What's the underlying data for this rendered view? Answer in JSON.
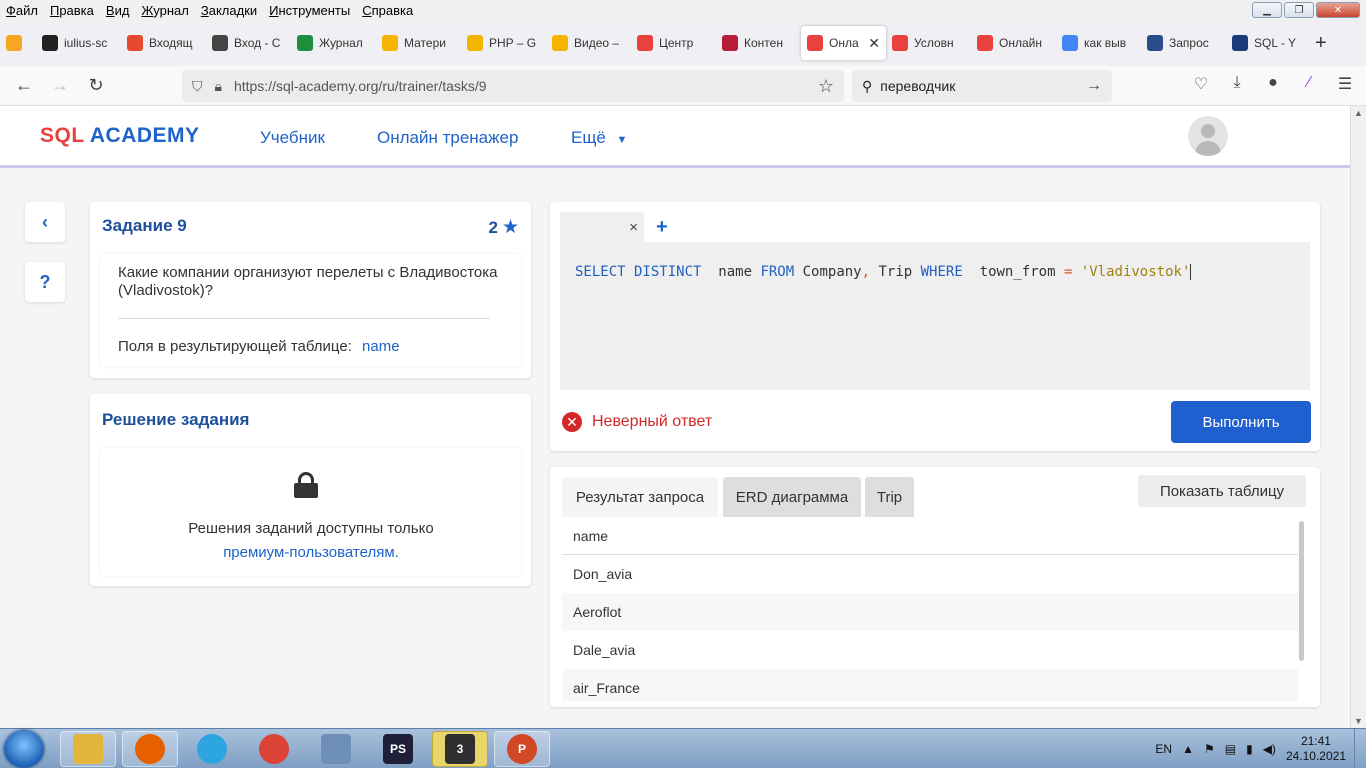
{
  "menu": [
    "Файл",
    "Правка",
    "Вид",
    "Журнал",
    "Закладки",
    "Инструменты",
    "Справка"
  ],
  "tabs": [
    {
      "label": "",
      "icon": "star-icon",
      "color": "#f5a623"
    },
    {
      "label": "iulius-sc",
      "icon": "github-icon",
      "color": "#222222"
    },
    {
      "label": "Входящ",
      "icon": "mail-icon",
      "color": "#e6492d"
    },
    {
      "label": "Вход - С",
      "icon": "asterisk-icon",
      "color": "#444444"
    },
    {
      "label": "Журнал",
      "icon": "sheets-icon",
      "color": "#1e8e3e"
    },
    {
      "label": "Матери",
      "icon": "drive-icon",
      "color": "#f4b400"
    },
    {
      "label": "PHP – G",
      "icon": "drive-icon",
      "color": "#f4b400"
    },
    {
      "label": "Видео –",
      "icon": "drive-icon",
      "color": "#f4b400"
    },
    {
      "label": "Центр",
      "icon": "circle-icon",
      "color": "#e8413e"
    },
    {
      "label": "Контен",
      "icon": "spiral-icon",
      "color": "#b51d3b"
    },
    {
      "label": "Онла",
      "icon": "sqlacademy-icon",
      "color": "#e8413e",
      "active": true
    },
    {
      "label": "Условн",
      "icon": "sqlacademy-icon",
      "color": "#e8413e"
    },
    {
      "label": "Онлайн",
      "icon": "sqlacademy-icon",
      "color": "#e8413e"
    },
    {
      "label": "как выв",
      "icon": "google-icon",
      "color": "#4285f4"
    },
    {
      "label": "Запрос",
      "icon": "site-icon",
      "color": "#2a4c8a"
    },
    {
      "label": "SQL - Y",
      "icon": "site-icon",
      "color": "#1a3a7a"
    }
  ],
  "url": "https://sql-academy.org/ru/trainer/tasks/9",
  "search_text": "переводчик",
  "site": {
    "logo_sql": "SQL",
    "logo_academy": "ACADEMY",
    "nav": [
      "Учебник",
      "Онлайн тренажер",
      "Ещё"
    ]
  },
  "sidebar": {
    "back": "‹",
    "help": "?"
  },
  "task": {
    "title": "Задание 9",
    "points": "2",
    "question": "Какие компании организуют перелеты с Владивостока (Vladivostok)?",
    "fields_label": "Поля в результирующей таблице:",
    "fields_value": "name"
  },
  "solution": {
    "title": "Решение задания",
    "text": "Решения заданий доступны только",
    "link": "премиум-пользователям."
  },
  "editor": {
    "close": "×",
    "add": "+",
    "code_tokens": [
      {
        "t": "SELECT DISTINCT",
        "c": "kw"
      },
      {
        "t": "  name ",
        "c": "id"
      },
      {
        "t": "FROM",
        "c": "kw"
      },
      {
        "t": " Company",
        "c": "id"
      },
      {
        "t": ",",
        "c": "op"
      },
      {
        "t": " Trip ",
        "c": "id"
      },
      {
        "t": "WHERE",
        "c": "kw"
      },
      {
        "t": "  town_from ",
        "c": "id"
      },
      {
        "t": "=",
        "c": "op"
      },
      {
        "t": " 'Vladivostok'",
        "c": "str"
      }
    ]
  },
  "status": {
    "error_text": "Неверный ответ"
  },
  "run_label": "Выполнить",
  "result": {
    "tabs": [
      "Результат запроса",
      "ERD диаграмма",
      "Trip"
    ],
    "show_table": "Показать таблицу",
    "column": "name",
    "rows": [
      "Don_avia",
      "Aeroflot",
      "Dale_avia",
      "air_France"
    ]
  },
  "taskbar": {
    "lang": "EN",
    "time": "21:41",
    "date": "24.10.2021",
    "apps": [
      {
        "name": "explorer-icon",
        "color": "#e2b53c"
      },
      {
        "name": "firefox-icon",
        "color": "#e66000"
      },
      {
        "name": "telegram-icon",
        "color": "#2ca5e0"
      },
      {
        "name": "chrome-icon",
        "color": "#db4437"
      },
      {
        "name": "calculator-icon",
        "color": "#6d8fb8"
      },
      {
        "name": "phpstorm-icon",
        "color": "#1f1f3a",
        "text": "PS"
      },
      {
        "name": "media-icon",
        "color": "#2f2f2f",
        "text": "3"
      },
      {
        "name": "powerpoint-icon",
        "color": "#d24726",
        "text": "P"
      }
    ]
  }
}
